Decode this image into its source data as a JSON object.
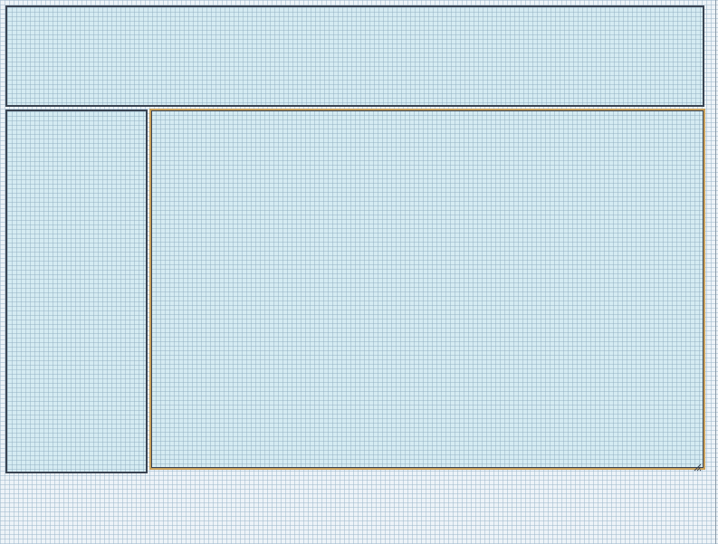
{
  "page": {
    "background_color": "#edf3f8",
    "grid_color": "#a0b9cd"
  },
  "panels": {
    "header": {
      "fill": "#d5ebf2",
      "border": "#3a4452"
    },
    "sidebar": {
      "fill": "#d5ebf2",
      "border": "#3a4452"
    },
    "main": {
      "fill": "#d5ebf2",
      "border": "#3a4452",
      "focus_border": "#c9a05a"
    }
  },
  "icons": {
    "resize_grip": "resize-grip-icon"
  }
}
